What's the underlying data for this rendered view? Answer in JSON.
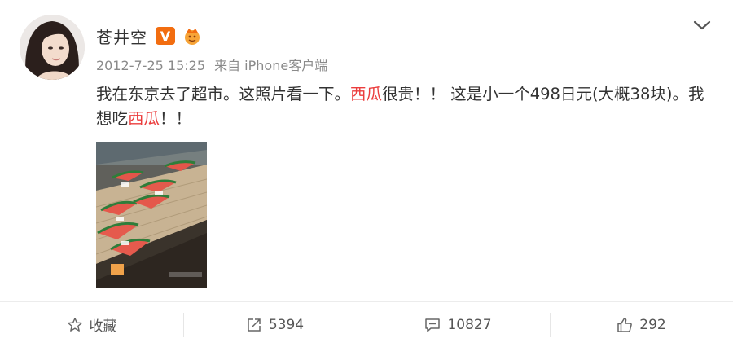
{
  "post": {
    "author": "苍井空",
    "time": "2012-7-25 15:25",
    "source": "来自 iPhone客户端",
    "vip_badge": "V",
    "text_parts": [
      "我在东京去了超市。这照片看一下。",
      "西瓜",
      "很贵！！ 这是小一个498日元(大概38块)。我想吃",
      "西瓜",
      "！！"
    ],
    "keyword_color": "#eb3d3d"
  },
  "toolbar": {
    "favorite_label": "收藏",
    "repost_count": "5394",
    "comment_count": "10827",
    "like_count": "292"
  },
  "icons": {
    "favorite": "star-outline-icon",
    "repost": "share-arrow-icon",
    "comment": "comment-bubble-icon",
    "like": "thumbs-up-icon",
    "menu": "chevron-down-icon",
    "vip": "verified-v-icon",
    "member": "member-crown-icon"
  }
}
